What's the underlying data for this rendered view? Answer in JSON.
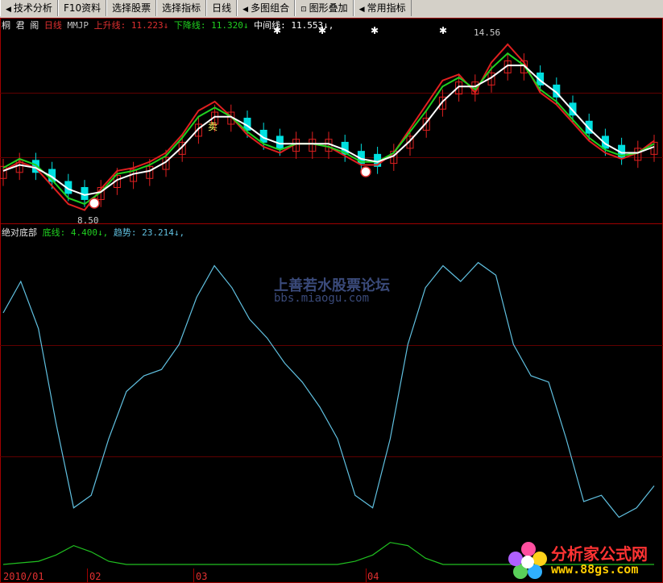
{
  "toolbar": {
    "items": [
      {
        "label": "技术分析",
        "arrow": "◀"
      },
      {
        "label": "F10资料",
        "arrow": ""
      },
      {
        "label": "选择股票",
        "arrow": ""
      },
      {
        "label": "选择指标",
        "arrow": ""
      },
      {
        "label": "日线",
        "arrow": ""
      },
      {
        "label": "多图组合",
        "arrow": "◀"
      },
      {
        "label": "图形叠加",
        "arrow": "⊡"
      },
      {
        "label": "常用指标",
        "arrow": "◀"
      }
    ]
  },
  "main_pane": {
    "stock_name": "桐 君 阁",
    "period": "日线",
    "indicator": "MMJP",
    "up_label": "上升线:",
    "up_value": "11.223↓",
    "down_label": "下降线:",
    "down_value": "11.320↓",
    "mid_label": "中间线:",
    "mid_value": "11.553↓,",
    "high_label": "14.56",
    "low_label": "8.50",
    "signal_sell": "卖",
    "colors": {
      "up": "#e02020",
      "down": "#20d020",
      "mid": "#ffffff",
      "up_candle": "#e02020",
      "down_candle": "#00e0e0"
    }
  },
  "sub_pane": {
    "title": "绝对底部",
    "bottom_label": "底线:",
    "bottom_value": "4.400↓,",
    "trend_label": "趋势:",
    "trend_value": "23.214↓,",
    "colors": {
      "trend": "#60c0e0",
      "bottom": "#20c020"
    }
  },
  "watermark": {
    "line1": "上善若水股票论坛",
    "line2": "bbs.miaogu.com"
  },
  "logo": {
    "line1": "分析家公式网",
    "line2": "www.88gs.com"
  },
  "dates": [
    "2010/01",
    "02",
    "03",
    "04"
  ],
  "chart_data": [
    {
      "type": "line",
      "title": "",
      "series": [
        {
          "name": "上升线",
          "values": [
            10.0,
            10.3,
            10.1,
            9.5,
            8.9,
            8.7,
            9.4,
            10.0,
            10.1,
            10.3,
            10.6,
            11.2,
            12.0,
            12.3,
            11.8,
            11.2,
            10.8,
            10.6,
            10.9,
            10.9,
            10.8,
            10.5,
            10.2,
            10.2,
            10.6,
            11.4,
            12.2,
            13.0,
            13.2,
            12.6,
            13.6,
            14.2,
            13.6,
            12.6,
            12.2,
            11.6,
            11.0,
            10.6,
            10.4,
            10.6,
            11.0
          ]
        },
        {
          "name": "下降线",
          "values": [
            10.1,
            10.4,
            10.2,
            9.7,
            9.1,
            8.9,
            9.3,
            9.9,
            10.0,
            10.2,
            10.5,
            11.1,
            11.8,
            12.1,
            11.8,
            11.3,
            10.9,
            10.7,
            10.9,
            10.9,
            10.8,
            10.6,
            10.3,
            10.3,
            10.6,
            11.3,
            12.0,
            12.8,
            13.1,
            12.7,
            13.4,
            13.9,
            13.5,
            12.7,
            12.3,
            11.7,
            11.1,
            10.7,
            10.5,
            10.6,
            10.9
          ]
        },
        {
          "name": "中间线",
          "values": [
            10.0,
            10.2,
            10.1,
            9.8,
            9.4,
            9.2,
            9.3,
            9.7,
            9.9,
            10.0,
            10.3,
            10.8,
            11.4,
            11.8,
            11.8,
            11.5,
            11.1,
            10.9,
            10.9,
            10.9,
            10.9,
            10.7,
            10.4,
            10.3,
            10.5,
            11.0,
            11.6,
            12.3,
            12.8,
            12.8,
            13.1,
            13.5,
            13.5,
            13.0,
            12.6,
            12.0,
            11.4,
            10.9,
            10.6,
            10.6,
            10.8
          ]
        }
      ]
    },
    {
      "type": "line",
      "title": "",
      "series": [
        {
          "name": "趋势",
          "values": [
            80,
            90,
            75,
            45,
            18,
            22,
            40,
            55,
            60,
            62,
            70,
            85,
            95,
            88,
            78,
            72,
            64,
            58,
            50,
            40,
            22,
            18,
            40,
            70,
            88,
            95,
            90,
            96,
            92,
            70,
            60,
            58,
            40,
            20,
            22,
            15,
            18,
            25
          ]
        },
        {
          "name": "底线",
          "values": [
            0,
            0.5,
            1,
            3,
            6,
            4,
            1,
            0,
            0,
            0,
            0,
            0,
            0,
            0,
            0,
            0,
            0,
            0,
            0,
            0,
            1,
            3,
            7,
            6,
            2,
            0,
            0,
            0,
            0,
            0,
            0,
            0,
            0,
            0,
            0,
            0,
            0,
            0
          ]
        }
      ]
    }
  ]
}
